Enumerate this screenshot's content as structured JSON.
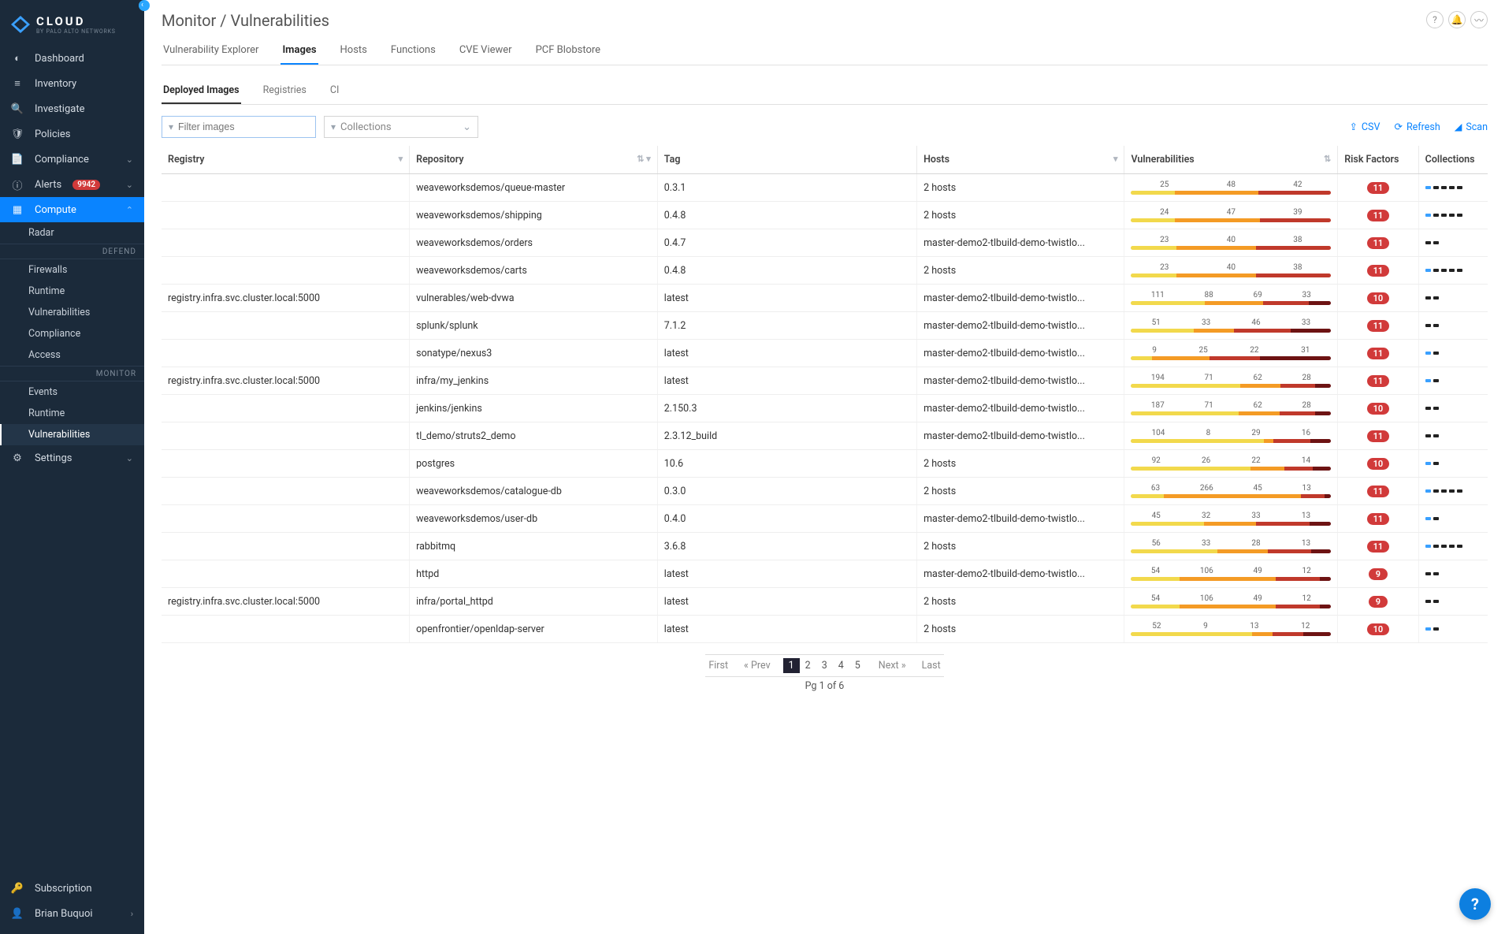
{
  "brand": {
    "name": "CLOUD",
    "sub": "BY PALO ALTO NETWORKS"
  },
  "sidebar": {
    "items": [
      {
        "label": "Dashboard",
        "icon": "gauge"
      },
      {
        "label": "Inventory",
        "icon": "list"
      },
      {
        "label": "Investigate",
        "icon": "search"
      },
      {
        "label": "Policies",
        "icon": "shield"
      },
      {
        "label": "Compliance",
        "icon": "doc",
        "chev": true
      },
      {
        "label": "Alerts",
        "icon": "info",
        "chev": true,
        "badge": "9942"
      },
      {
        "label": "Compute",
        "icon": "chip",
        "chev": true,
        "active": true
      },
      {
        "label": "Settings",
        "icon": "gear",
        "chev": true
      }
    ],
    "compute": {
      "radar": "Radar",
      "defend_head": "DEFEND",
      "defend": [
        "Firewalls",
        "Runtime",
        "Vulnerabilities",
        "Compliance",
        "Access"
      ],
      "monitor_head": "MONITOR",
      "monitor": [
        "Events",
        "Runtime",
        "Vulnerabilities"
      ],
      "monitor_active": "Vulnerabilities"
    },
    "footer": {
      "subscription": "Subscription",
      "user": "Brian Buquoi"
    }
  },
  "header": {
    "breadcrumb": "Monitor / Vulnerabilities",
    "tabs": [
      "Vulnerability Explorer",
      "Images",
      "Hosts",
      "Functions",
      "CVE Viewer",
      "PCF Blobstore"
    ],
    "active": "Images",
    "subtabs": [
      "Deployed Images",
      "Registries",
      "CI"
    ],
    "subactive": "Deployed Images"
  },
  "toolbar": {
    "filter_placeholder": "Filter images",
    "collections_label": "Collections",
    "csv": "CSV",
    "refresh": "Refresh",
    "scan": "Scan"
  },
  "columns": {
    "registry": "Registry",
    "repository": "Repository",
    "tag": "Tag",
    "hosts": "Hosts",
    "vuln": "Vulnerabilities",
    "risk": "Risk Factors",
    "coll": "Collections"
  },
  "colors": {
    "low": "#f2d94c",
    "med": "#f49b25",
    "high": "#c0392b",
    "crit": "#6d1313"
  },
  "rows": [
    {
      "registry": "",
      "repo": "weaveworksdemos/queue-master",
      "tag": "0.3.1",
      "hosts": "2 hosts",
      "v": [
        25,
        48,
        42,
        0
      ],
      "risk": "11",
      "coll": [
        "#3aa0ff",
        "#222",
        "#222",
        "#222",
        "#222"
      ]
    },
    {
      "registry": "",
      "repo": "weaveworksdemos/shipping",
      "tag": "0.4.8",
      "hosts": "2 hosts",
      "v": [
        24,
        47,
        39,
        0
      ],
      "risk": "11",
      "coll": [
        "#3aa0ff",
        "#222",
        "#222",
        "#222",
        "#222"
      ]
    },
    {
      "registry": "",
      "repo": "weaveworksdemos/orders",
      "tag": "0.4.7",
      "hosts": "master-demo2-tlbuild-demo-twistlo...",
      "v": [
        23,
        40,
        38,
        0
      ],
      "risk": "11",
      "coll": [
        "#222",
        "#222"
      ]
    },
    {
      "registry": "",
      "repo": "weaveworksdemos/carts",
      "tag": "0.4.8",
      "hosts": "2 hosts",
      "v": [
        23,
        40,
        38,
        0
      ],
      "risk": "11",
      "coll": [
        "#3aa0ff",
        "#222",
        "#222",
        "#222",
        "#222"
      ]
    },
    {
      "registry": "registry.infra.svc.cluster.local:5000",
      "repo": "vulnerables/web-dvwa",
      "tag": "latest",
      "hosts": "master-demo2-tlbuild-demo-twistlo...",
      "v": [
        111,
        88,
        69,
        33
      ],
      "risk": "10",
      "coll": [
        "#222",
        "#222"
      ]
    },
    {
      "registry": "",
      "repo": "splunk/splunk",
      "tag": "7.1.2",
      "hosts": "master-demo2-tlbuild-demo-twistlo...",
      "v": [
        51,
        33,
        46,
        33
      ],
      "risk": "11",
      "coll": [
        "#222",
        "#222"
      ]
    },
    {
      "registry": "",
      "repo": "sonatype/nexus3",
      "tag": "latest",
      "hosts": "master-demo2-tlbuild-demo-twistlo...",
      "v": [
        9,
        25,
        22,
        31
      ],
      "risk": "11",
      "coll": [
        "#3aa0ff",
        "#222"
      ]
    },
    {
      "registry": "registry.infra.svc.cluster.local:5000",
      "repo": "infra/my_jenkins",
      "tag": "latest",
      "hosts": "master-demo2-tlbuild-demo-twistlo...",
      "v": [
        194,
        71,
        62,
        28
      ],
      "risk": "11",
      "coll": [
        "#3aa0ff",
        "#222"
      ]
    },
    {
      "registry": "",
      "repo": "jenkins/jenkins",
      "tag": "2.150.3",
      "hosts": "master-demo2-tlbuild-demo-twistlo...",
      "v": [
        187,
        71,
        62,
        28
      ],
      "risk": "10",
      "coll": [
        "#222",
        "#222"
      ]
    },
    {
      "registry": "",
      "repo": "tl_demo/struts2_demo",
      "tag": "2.3.12_build",
      "hosts": "master-demo2-tlbuild-demo-twistlo...",
      "v": [
        104,
        8,
        29,
        16
      ],
      "risk": "11",
      "coll": [
        "#222",
        "#222"
      ]
    },
    {
      "registry": "",
      "repo": "postgres",
      "tag": "10.6",
      "hosts": "2 hosts",
      "v": [
        92,
        26,
        22,
        14
      ],
      "risk": "10",
      "coll": [
        "#3aa0ff",
        "#222"
      ]
    },
    {
      "registry": "",
      "repo": "weaveworksdemos/catalogue-db",
      "tag": "0.3.0",
      "hosts": "2 hosts",
      "v": [
        63,
        266,
        45,
        13
      ],
      "risk": "11",
      "coll": [
        "#3aa0ff",
        "#222",
        "#222",
        "#222",
        "#222"
      ]
    },
    {
      "registry": "",
      "repo": "weaveworksdemos/user-db",
      "tag": "0.4.0",
      "hosts": "master-demo2-tlbuild-demo-twistlo...",
      "v": [
        45,
        32,
        33,
        13
      ],
      "risk": "11",
      "coll": [
        "#3aa0ff",
        "#222"
      ]
    },
    {
      "registry": "",
      "repo": "rabbitmq",
      "tag": "3.6.8",
      "hosts": "2 hosts",
      "v": [
        56,
        33,
        28,
        13
      ],
      "risk": "11",
      "coll": [
        "#3aa0ff",
        "#222",
        "#222",
        "#222",
        "#222"
      ]
    },
    {
      "registry": "",
      "repo": "httpd",
      "tag": "latest",
      "hosts": "master-demo2-tlbuild-demo-twistlo...",
      "v": [
        54,
        106,
        49,
        12
      ],
      "risk": "9",
      "coll": [
        "#222",
        "#222"
      ]
    },
    {
      "registry": "registry.infra.svc.cluster.local:5000",
      "repo": "infra/portal_httpd",
      "tag": "latest",
      "hosts": "2 hosts",
      "v": [
        54,
        106,
        49,
        12
      ],
      "risk": "9",
      "coll": [
        "#222",
        "#222"
      ]
    },
    {
      "registry": "",
      "repo": "openfrontier/openldap-server",
      "tag": "latest",
      "hosts": "2 hosts",
      "v": [
        52,
        9,
        13,
        12
      ],
      "risk": "10",
      "coll": [
        "#3aa0ff",
        "#222"
      ]
    }
  ],
  "pager": {
    "first": "First",
    "prev": "Prev",
    "pages": [
      "1",
      "2",
      "3",
      "4",
      "5"
    ],
    "active": "1",
    "next": "Next",
    "last": "Last",
    "summary": "Pg 1 of 6"
  }
}
